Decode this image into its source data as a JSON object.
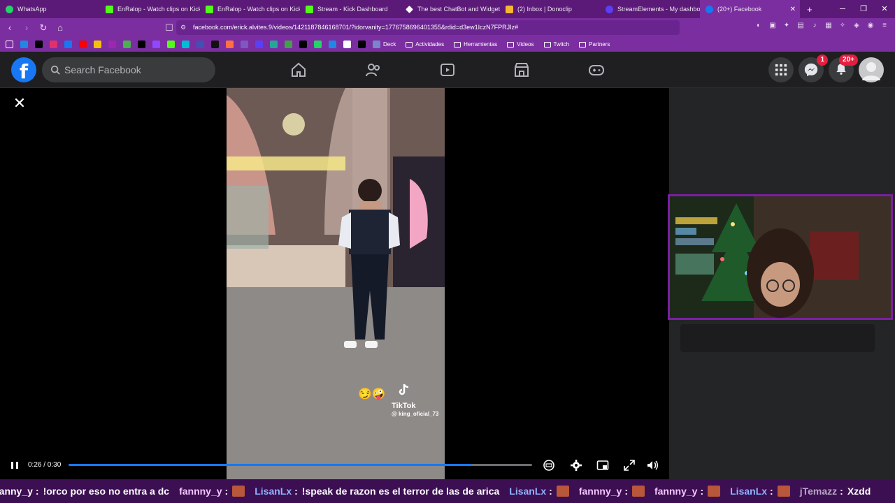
{
  "browser": {
    "tabs": [
      {
        "label": "WhatsApp",
        "color": "#25d366"
      },
      {
        "label": "EnRalop - Watch clips on Kick",
        "color": "#53fc18"
      },
      {
        "label": "EnRalop - Watch clips on Kick",
        "color": "#53fc18"
      },
      {
        "label": "Stream - Kick Dashboard",
        "color": "#53fc18"
      },
      {
        "label": "The best ChatBot and Widgets",
        "color": "#ffffff"
      },
      {
        "label": "(2) Inbox | Donoclip",
        "color": "#f7b731"
      },
      {
        "label": "StreamElements - My dashboard",
        "color": "#5a3ff5"
      },
      {
        "label": "(20+) Facebook",
        "color": "#1877f2"
      }
    ],
    "url": "facebook.com/erick.alvites.9/videos/1421187846168701/?idorvanity=1776758696401355&rdid=d3ew1IczN7FPRJIz#",
    "bookmarks": {
      "folders": [
        "Deck",
        "Actividades",
        "Herramientas",
        "Videos",
        "Twitch",
        "Partners"
      ]
    }
  },
  "facebook": {
    "logo": "f",
    "search_placeholder": "Search Facebook",
    "messenger_badge": "1",
    "notifications_badge": "20+"
  },
  "video": {
    "time": "0:26 / 0:30",
    "progress": 0.87,
    "tiktok_label": "TikTok",
    "tiktok_handle": "@ king_oficial_73"
  },
  "chat_ticker": [
    {
      "user": "fanny_y",
      "color": "#ffffff",
      "message": "!orco por eso no entra a dc"
    },
    {
      "user": "fannny_y",
      "color": "#f7c6ff",
      "message": "",
      "emote": true
    },
    {
      "user": "LisanLx",
      "color": "#8fb4ff",
      "message": "!speak de razon es el terror de las de arica"
    },
    {
      "user": "LisanLx",
      "color": "#8fb4ff",
      "message": "",
      "emote": true
    },
    {
      "user": "fannny_y",
      "color": "#f7c6ff",
      "message": "",
      "emote": true
    },
    {
      "user": "fannny_y",
      "color": "#f7c6ff",
      "message": "",
      "emote": true
    },
    {
      "user": "LisanLx",
      "color": "#8fb4ff",
      "message": "",
      "emote": true
    },
    {
      "user": "jTemazz",
      "color": "#b9a6c5",
      "message": "Xzdd"
    }
  ]
}
